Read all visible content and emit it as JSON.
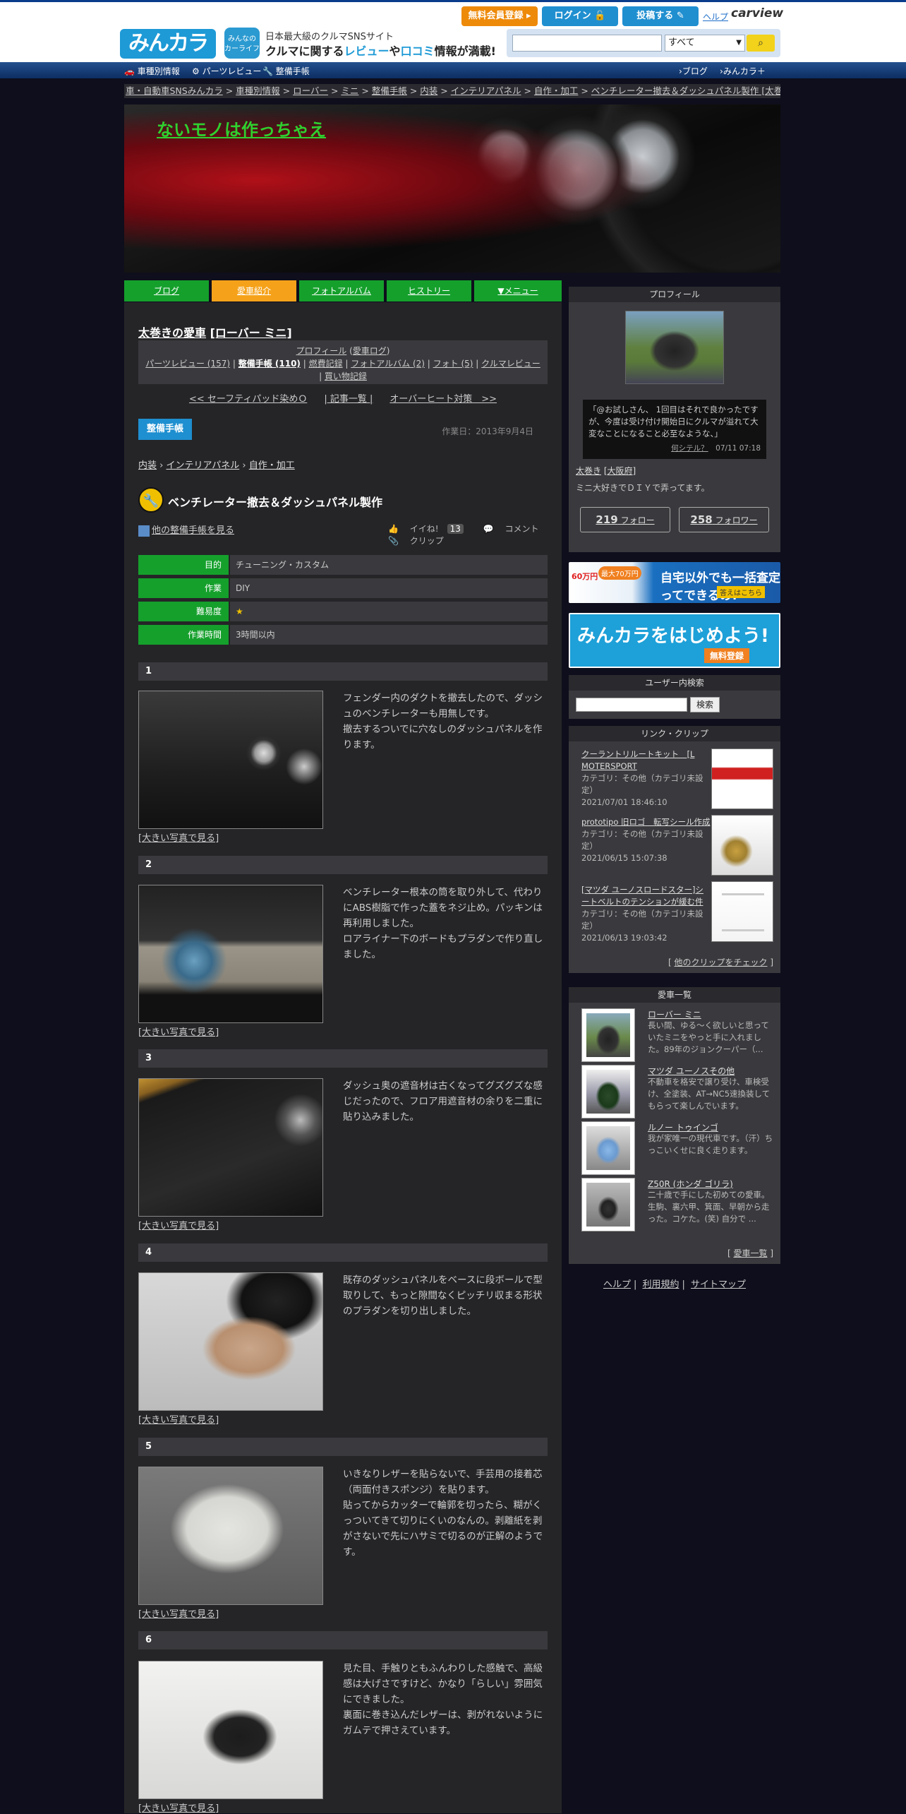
{
  "header": {
    "logo": "みんカラ",
    "badge": "みんなの\nカーライフ",
    "tagline_top": "日本最大級のクルマSNSサイト",
    "tagline_a": "クルマに関する",
    "tagline_b": "レビュー",
    "tagline_c": "や",
    "tagline_d": "口コミ",
    "tagline_e": "情報が満載!",
    "register": "無料会員登録",
    "login": "ログイン",
    "post": "投稿する",
    "help": "ヘルプ",
    "carview": "carview",
    "search_scope": "すべて"
  },
  "nav": {
    "cars": "車種別情報",
    "parts": "パーツレビュー",
    "seibi": "整備手帳",
    "blog": "ブログ",
    "minkara_plus": "みんカラ＋"
  },
  "breadcrumb": [
    "車・自動車SNSみんカラ",
    "車種別情報",
    "ローバー",
    "ミニ",
    "整備手帳",
    "内装",
    "インテリアパネル",
    "自作・加工",
    "ベンチレーター撤去＆ダッシュパネル製作 [太巻き]"
  ],
  "banner_title": "ないモノは作っちゃえ",
  "tabs": [
    "ブログ",
    "愛車紹介",
    "フォトアルバム",
    "ヒストリー",
    "▼メニュー"
  ],
  "car": {
    "owner": "太巻きの愛車",
    "model": "[ローバー ミニ]"
  },
  "profile_links": {
    "profile": "プロフィール",
    "car_log": "愛車ログ",
    "parts": "パーツレビュー (157)",
    "seibi": "整備手帳 (110)",
    "nenpi": "燃費記録",
    "album": "フォトアルバム (2)",
    "photo": "フォト (5)",
    "review": "クルマレビュー",
    "shopping": "買い物記録"
  },
  "prevnext": {
    "prev": "<< セーフティパッド染めＯ",
    "list": "| 記事一覧 |",
    "next": "オーバーヒート対策　>>"
  },
  "seibi_tag": "整備手帳",
  "work_date": "作業日：2013年9月4日",
  "category": [
    "内装",
    "インテリアパネル",
    "自作・加工"
  ],
  "entry_title": "ベンチレーター撤去＆ダッシュパネル製作",
  "other_link": "他の整備手帳を見る",
  "actions": {
    "iine": "イイね!",
    "iine_count": "13",
    "comment": "コメント",
    "clip": "クリップ"
  },
  "info": [
    {
      "k": "目的",
      "v": "チューニング・カスタム"
    },
    {
      "k": "作業",
      "v": "DIY"
    },
    {
      "k": "難易度",
      "v": "★"
    },
    {
      "k": "作業時間",
      "v": "3時間以内"
    }
  ],
  "big_photo_link": "[大きい写真で見る]",
  "steps": [
    {
      "num": "1",
      "text": "フェンダー内のダクトを撤去したので、ダッシュのベンチレーターも用無しです。\n撤去するついでに穴なしのダッシュパネルを作ります。"
    },
    {
      "num": "2",
      "text": "ベンチレーター根本の筒を取り外して、代わりにABS樹脂で作った蓋をネジ止め。パッキンは再利用しました。\nロアライナー下のボードもプラダンで作り直しました。"
    },
    {
      "num": "3",
      "text": "ダッシュ奥の遮音材は古くなってグズグズな感じだったので、フロア用遮音材の余りを二重に貼り込みました。"
    },
    {
      "num": "4",
      "text": "既存のダッシュパネルをベースに段ボールで型取りして、もっと隙間なくピッチリ収まる形状のプラダンを切り出しました。"
    },
    {
      "num": "5",
      "text": "いきなりレザーを貼らないで、手芸用の接着芯（両面付きスポンジ）を貼ります。\n貼ってからカッターで輪郭を切ったら、糊がくっついてきて切りにくいのなんの。剥離紙を剥がさないで先にハサミで切るのが正解のようです。"
    },
    {
      "num": "6",
      "text": "見た目、手触りともふんわりした感触で、高級感は大げさですけど、かなり「らしい」雰囲気にできました。\n裏面に巻き込んだレザーは、剥がれないようにガムテで押さえています。"
    }
  ],
  "sidebar": {
    "profile_head": "プロフィール",
    "quote": "「@お試しさん、 1回目はそれで良かったですが、今度は受け付け開始日にクルマが溢れて大変なことになること必至なような、」",
    "quote_link": "何シテル？",
    "quote_time": "07/11 07:18",
    "name": "太巻き",
    "name_sub": "[大阪府]",
    "desc": "ミニ大好きでＤＩＹで弄ってます。",
    "follow_n": "219",
    "follow_l": "フォロー",
    "follower_n": "258",
    "follower_l": "フォロワー",
    "ad1_text": "自宅以外でも一括査定ってできるの?",
    "ad1_tag": "最大70万円",
    "ad1_tag2": "60万円",
    "ad1_cta": "答えはこちら",
    "ad2_text": "みんカラをはじめよう!",
    "ad2_cta": "無料登録",
    "user_search_head": "ユーザー内検索",
    "user_search_btn": "検索",
    "clips_head": "リンク・クリップ",
    "clips": [
      {
        "title": "クーラントリルートキット　[L MOTERSPORT",
        "cat": "カテゴリ：その他（カテゴリ未設定）",
        "date": "2021/07/01 18:46:10"
      },
      {
        "title": "prototipo 旧ロゴ　転写シール作成",
        "cat": "カテゴリ：その他（カテゴリ未設定）",
        "date": "2021/06/15 15:07:38"
      },
      {
        "title": "[マツダ ユーノスロードスター]シートベルトのテンションが緩む件",
        "cat": "カテゴリ：その他（カテゴリ未設定）",
        "date": "2021/06/13 19:03:42"
      }
    ],
    "clips_more": "他のクリップをチェック",
    "cars_head": "愛車一覧",
    "cars": [
      {
        "name": "ローバー ミニ",
        "desc": "長い間、ゆる～く欲しいと思っていたミニをやっと手に入れました。89年のジョンクーパー（..."
      },
      {
        "name": "マツダ ユーノスその他",
        "desc": "不動車を格安で譲り受け、車検受け、全塗装、AT→NC5速換装してもらって楽しんでいます。"
      },
      {
        "name": "ルノー トゥインゴ",
        "desc": "我が家唯一の現代車です。（汗）ちっこいくせに良く走ります。"
      },
      {
        "name": "Z50R (ホンダ ゴリラ)",
        "desc": "二十歳で手にした初めての愛車。生駒、裏六甲、箕面、早朝から走った。コケた。(笑) 自分で ..."
      }
    ],
    "cars_more": "愛車一覧",
    "footer": [
      "ヘルプ",
      "利用規約",
      "サイトマップ"
    ]
  }
}
